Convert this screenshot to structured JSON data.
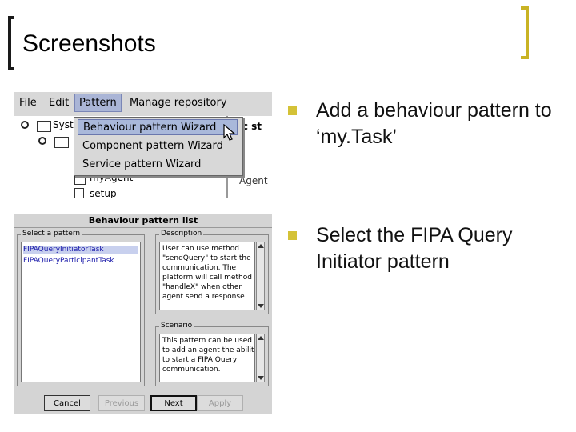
{
  "slide": {
    "title": "Screenshots",
    "bullets": [
      "Add a behaviour pattern to ‘my.Task’",
      "Select the FIPA Query Initiator pattern"
    ]
  },
  "menubar": {
    "items": [
      "File",
      "Edit",
      "Pattern",
      "Manage repository"
    ],
    "active": "Pattern"
  },
  "pattern_menu": {
    "items": [
      "Behaviour pattern Wizard",
      "Component pattern Wizard",
      "Service pattern Wizard"
    ],
    "selected": "Behaviour pattern Wizard"
  },
  "tree": {
    "rows": [
      "Syst",
      "myAgent",
      "setup"
    ],
    "right_fragments": [
      "tic st",
      "Agent"
    ]
  },
  "dialog": {
    "title": "Behaviour pattern list",
    "select_label": "Select a pattern",
    "patterns": [
      "FIPAQueryInitiatorTask",
      "FIPAQueryParticipantTask"
    ],
    "selected_pattern": "FIPAQueryInitiatorTask",
    "description_label": "Description",
    "description": "User can use method\n\"sendQuery\" to start the\ncommunication. The\nplatform will call method\n\"handleX\" when other\nagent send a response",
    "scenario_label": "Scenario",
    "scenario": "This pattern can be used\nto add an agent the ability\nto start a FIPA Query\ncommunication.",
    "buttons": {
      "cancel": "Cancel",
      "previous": "Previous",
      "next": "Next",
      "apply": "Apply"
    }
  },
  "colors": {
    "accent_bracket": "#c9b324",
    "bullet_marker": "#d4c237",
    "menu_highlight": "#a9b8da"
  }
}
